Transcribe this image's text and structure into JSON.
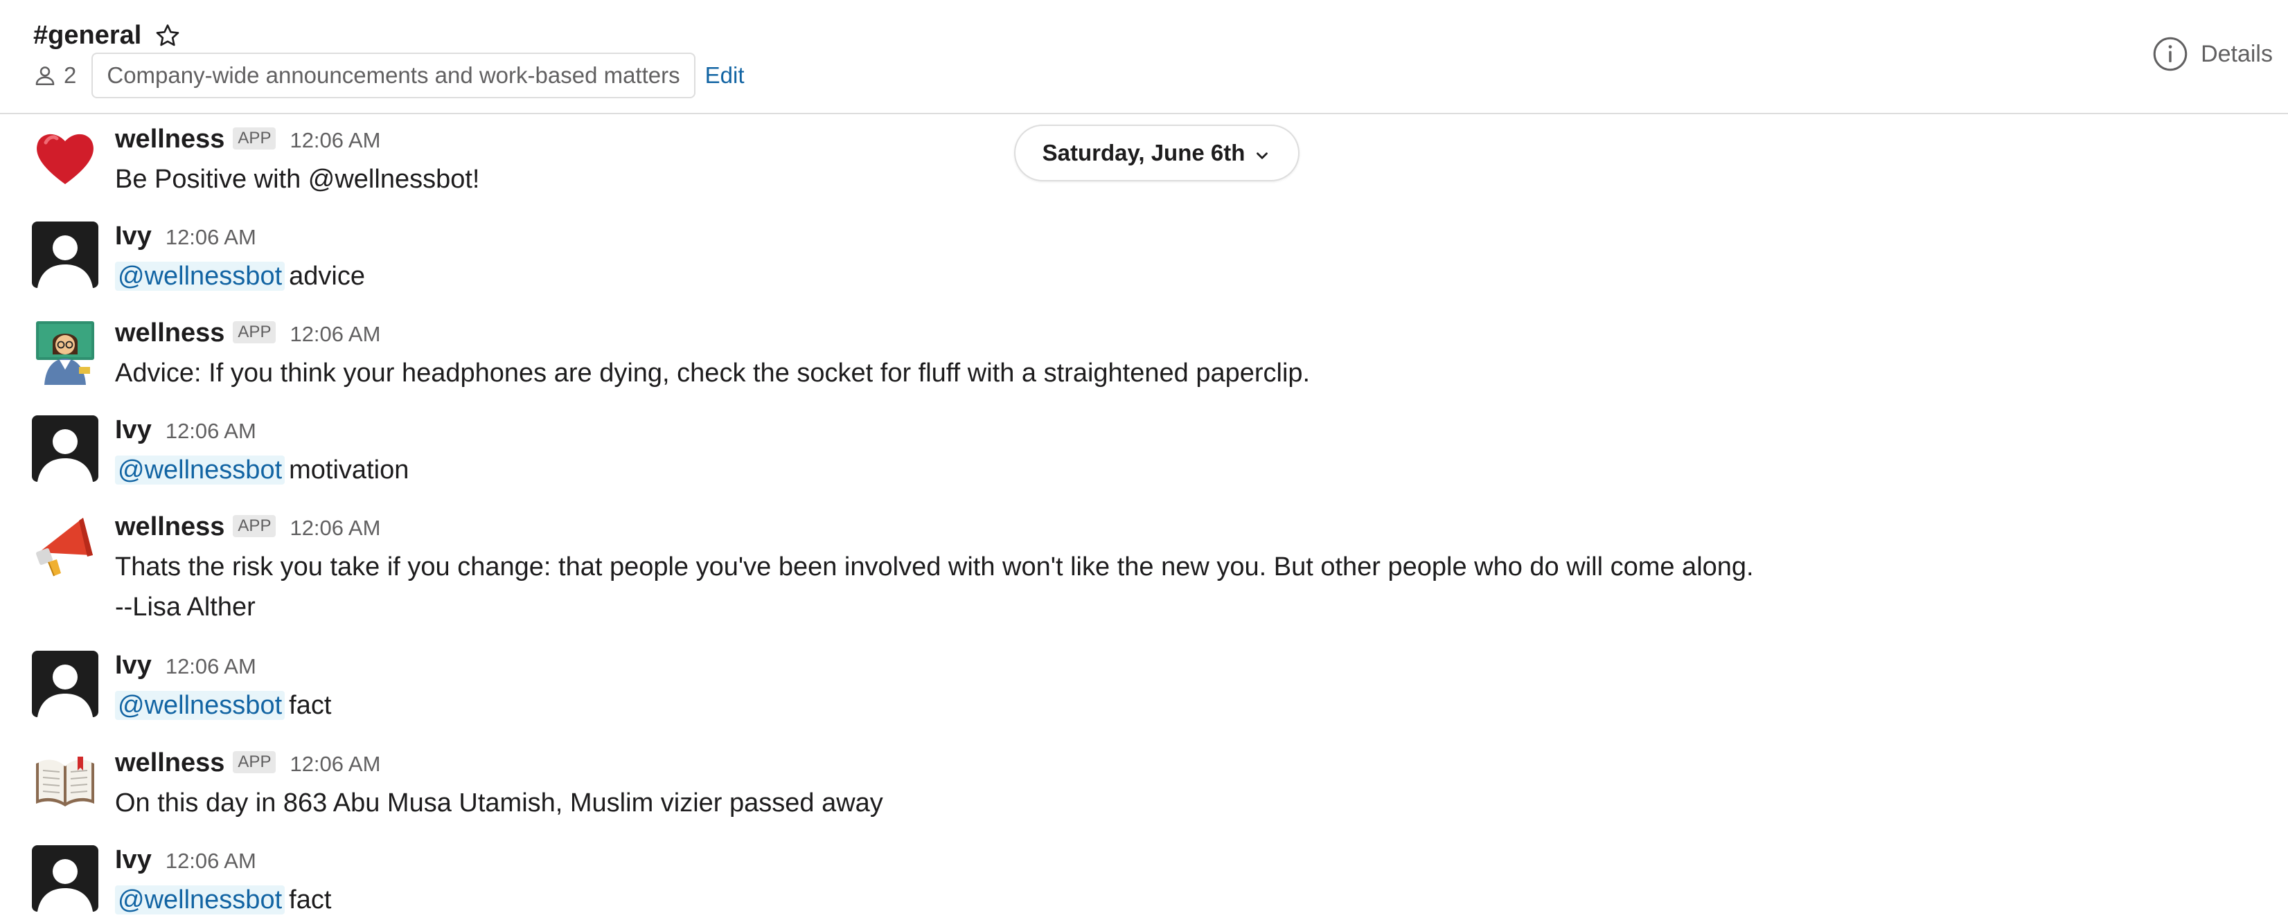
{
  "header": {
    "channel_name": "#general",
    "member_count": "2",
    "topic": "Company-wide announcements and work-based matters",
    "edit_label": "Edit",
    "details_label": "Details",
    "icons": [
      "star-icon",
      "person-icon",
      "info-icon"
    ]
  },
  "date_divider": {
    "label": "Saturday, June 6th",
    "icon": "chevron-down-icon"
  },
  "app_badge": "APP",
  "colors": {
    "link": "#1264a3",
    "mention_bg": "#e8f5fa",
    "text": "#1d1c1d",
    "muted": "#616061"
  },
  "messages": [
    {
      "sender": "wellness",
      "is_app": true,
      "time": "12:06 AM",
      "avatar": "heart-emoji",
      "text": "Be Positive with @wellnessbot!"
    },
    {
      "sender": "Ivy",
      "is_app": false,
      "time": "12:06 AM",
      "avatar": "default-user",
      "mention": "@wellnessbot",
      "text": "advice"
    },
    {
      "sender": "wellness",
      "is_app": true,
      "time": "12:06 AM",
      "avatar": "teacher-emoji",
      "text": "Advice: If you think your headphones are dying, check the socket for fluff with a straightened paperclip."
    },
    {
      "sender": "Ivy",
      "is_app": false,
      "time": "12:06 AM",
      "avatar": "default-user",
      "mention": "@wellnessbot",
      "text": "motivation"
    },
    {
      "sender": "wellness",
      "is_app": true,
      "time": "12:06 AM",
      "avatar": "megaphone-emoji",
      "text": "Thats the risk you take if you change: that people you've been involved with won't like the new you. But other people who do will come along.",
      "text2": "--Lisa Alther"
    },
    {
      "sender": "Ivy",
      "is_app": false,
      "time": "12:06 AM",
      "avatar": "default-user",
      "mention": "@wellnessbot",
      "text": "fact"
    },
    {
      "sender": "wellness",
      "is_app": true,
      "time": "12:06 AM",
      "avatar": "book-emoji",
      "text": "On this day in 863 Abu Musa Utamish, Muslim vizier passed away"
    },
    {
      "sender": "Ivy",
      "is_app": false,
      "time": "12:06 AM",
      "avatar": "default-user",
      "mention": "@wellnessbot",
      "text": "fact"
    }
  ]
}
